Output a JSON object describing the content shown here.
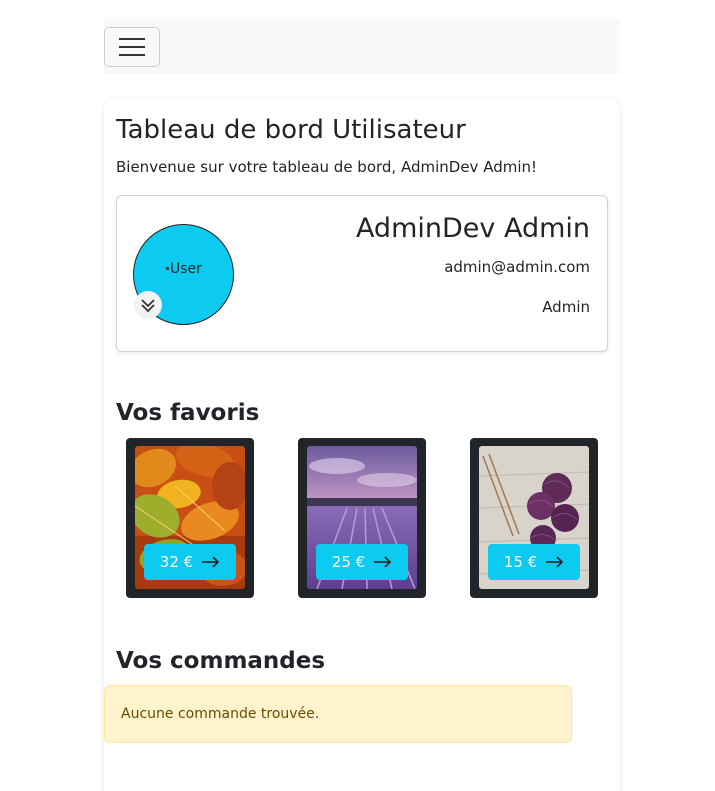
{
  "navbar": {
    "toggle_icon": "hamburger-icon"
  },
  "dashboard": {
    "title": "Tableau de bord Utilisateur",
    "welcome": "Bienvenue sur votre tableau de bord, AdminDev Admin!"
  },
  "profile": {
    "avatar_alt": "User",
    "avatar_color": "#0dcaf0",
    "name": "AdminDev Admin",
    "email": "admin@admin.com",
    "role": "Admin"
  },
  "favorites": {
    "title": "Vos favoris",
    "items": [
      {
        "price": "32 €",
        "image": "autumn-leaves"
      },
      {
        "price": "25 €",
        "image": "lavender-field"
      },
      {
        "price": "15 €",
        "image": "purple-yarn-balls"
      }
    ]
  },
  "orders": {
    "title": "Vos commandes",
    "empty_message": "Aucune commande trouvée."
  },
  "colors": {
    "accent": "#0dcaf0",
    "card_dark": "#212529",
    "alert_bg": "#fff3cd",
    "alert_text": "#664d03"
  }
}
